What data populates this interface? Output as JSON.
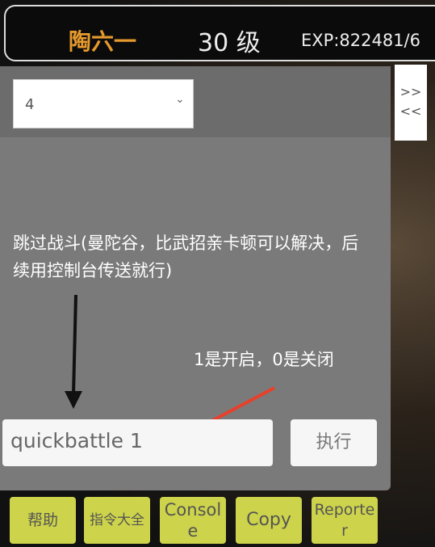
{
  "header": {
    "name": "陶六一",
    "level": "30 级",
    "exp": "EXP:822481/6"
  },
  "select": {
    "value": "4"
  },
  "toggle": {
    "expand": ">>",
    "collapse": "<<"
  },
  "annotations": {
    "main": "跳过战斗(曼陀谷，比武招亲卡顿可以解决，后续用控制台传送就行)",
    "toggle_note": "1是开启，0是关闭"
  },
  "command": {
    "value": "quickbattle 1",
    "execute": "执行"
  },
  "buttons": [
    "帮助",
    "指令大全",
    "Console",
    "Copy",
    "Reporter"
  ],
  "colors": {
    "name": "#e69a2e",
    "button": "#cdd34a",
    "arrow_red": "#e8402a"
  }
}
